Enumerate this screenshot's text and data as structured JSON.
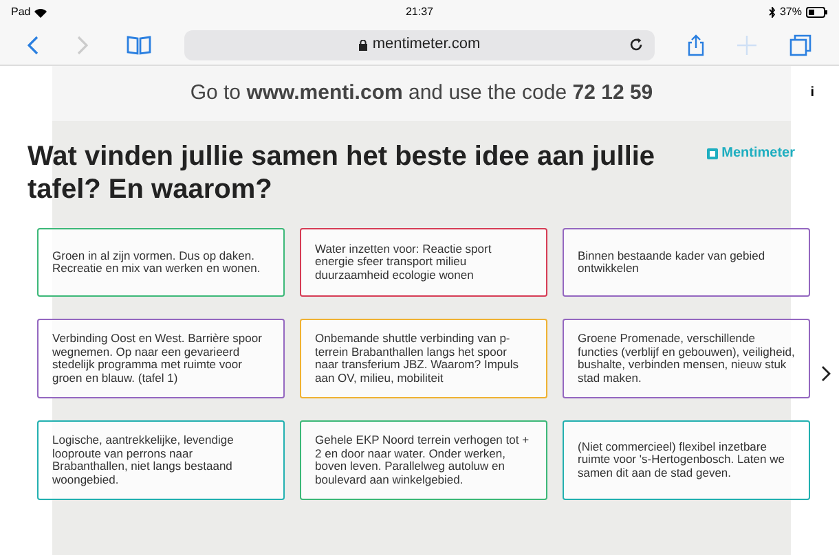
{
  "status_bar": {
    "device": "Pad",
    "time": "21:37",
    "battery": "37%"
  },
  "browser": {
    "url": "mentimeter.com"
  },
  "join_banner": {
    "text": "Go to **www.menti.com** and use the code **72 12 59**",
    "info": "i"
  },
  "slide": {
    "title": "Wat vinden jullie samen het beste idee aan jullie tafel? En waarom?",
    "brand": "Mentimeter",
    "responses": [
      {
        "text": "Groen in al zijn vormen. Dus op daken. Recreatie en mix van werken en wonen.",
        "color": "#3cb878"
      },
      {
        "text": "Water inzetten voor: Reactie sport energie sfeer transport milieu duurzaamheid ecologie wonen",
        "color": "#d63c55"
      },
      {
        "text": "Binnen bestaande kader van gebied ontwikkelen",
        "color": "#9467c0"
      },
      {
        "text": "Verbinding Oost en West. Barrière spoor wegnemen. Op naar een gevarieerd stedelijk programma met ruimte voor groen en blauw. (tafel 1)",
        "color": "#9467c0"
      },
      {
        "text": "Onbemande shuttle verbinding van p-terrein Brabanthallen langs het spoor naar transferium JBZ. Waarom? Impuls aan OV, milieu, mobiliteit",
        "color": "#f0b232"
      },
      {
        "text": "Groene Promenade, verschillende functies (verblijf en gebouwen), veiligheid, bushalte, verbinden mensen, nieuw stuk stad maken.",
        "color": "#9467c0"
      },
      {
        "text": "Logische, aantrekkelijke, levendige looproute van perrons naar Brabanthallen, niet langs bestaand woongebied.",
        "color": "#22b0b0"
      },
      {
        "text": "Gehele EKP Noord terrein verhogen tot + 2 en door naar water. Onder werken, boven leven. Parallelweg autoluw en boulevard aan winkelgebied.",
        "color": "#3cb878"
      },
      {
        "text": "(Niet commercieel) flexibel inzetbare ruimte voor 's-Hertogenbosch. Laten we samen dit aan de stad geven.",
        "color": "#22b0b0"
      }
    ]
  }
}
